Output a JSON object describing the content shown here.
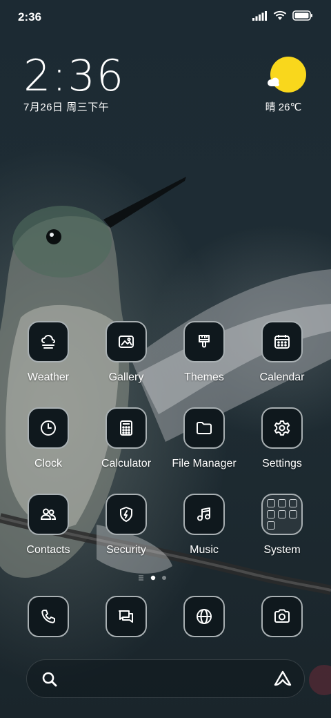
{
  "status_bar": {
    "time": "2:36"
  },
  "clock_widget": {
    "time": "2:36",
    "date": "7月26日 周三下午"
  },
  "weather_widget": {
    "summary": "晴 26℃",
    "icon": "sun-cloud-icon"
  },
  "apps": [
    {
      "label": "Weather",
      "icon": "weather-icon"
    },
    {
      "label": "Gallery",
      "icon": "gallery-icon"
    },
    {
      "label": "Themes",
      "icon": "themes-brush-icon"
    },
    {
      "label": "Calendar",
      "icon": "calendar-icon"
    },
    {
      "label": "Clock",
      "icon": "clock-icon"
    },
    {
      "label": "Calculator",
      "icon": "calculator-icon"
    },
    {
      "label": "File Manager",
      "icon": "folder-icon"
    },
    {
      "label": "Settings",
      "icon": "gear-icon"
    },
    {
      "label": "Contacts",
      "icon": "contacts-icon"
    },
    {
      "label": "Security",
      "icon": "shield-icon"
    },
    {
      "label": "Music",
      "icon": "music-note-icon"
    },
    {
      "label": "System",
      "icon": "folder-grid-icon"
    }
  ],
  "dock": [
    {
      "icon": "phone-icon"
    },
    {
      "icon": "messages-icon"
    },
    {
      "icon": "browser-globe-icon"
    },
    {
      "icon": "camera-icon"
    }
  ],
  "page_indicator": {
    "pages": 3,
    "current": 2
  },
  "colors": {
    "icon_bg": "#0f181d",
    "icon_border": "#a9b0b3",
    "sun": "#f9d71c"
  }
}
